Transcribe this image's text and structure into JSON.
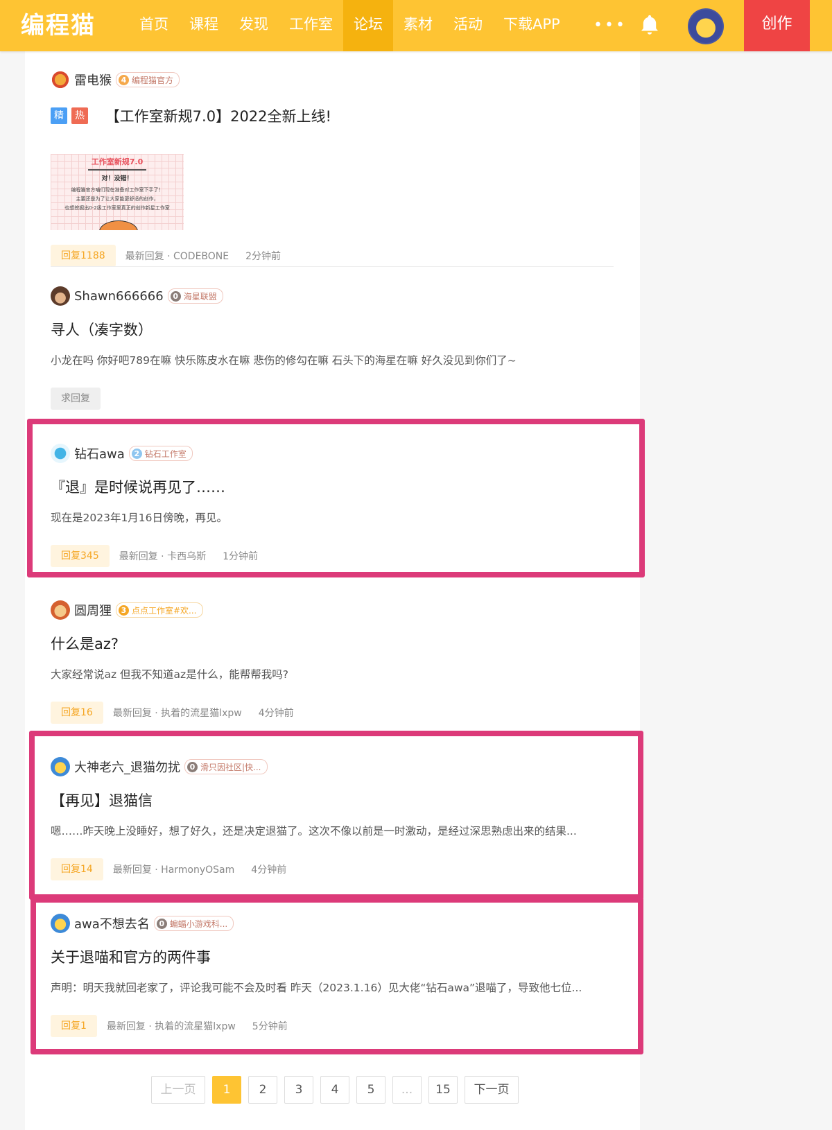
{
  "header": {
    "logo": "编程猫",
    "nav": [
      "首页",
      "课程",
      "发现",
      "工作室",
      "论坛",
      "素材",
      "活动",
      "下载APP"
    ],
    "active_nav": "论坛",
    "more": "•••",
    "create_label": "创作"
  },
  "posts": [
    {
      "author": "雷电猴",
      "badge_level": "4",
      "badge_text": "编程猫官方",
      "tags": [
        "精",
        "热"
      ],
      "title": "【工作室新规7.0】2022全新上线!",
      "thumb": {
        "heading": "工作室新规7.0",
        "sub": "对！没错！",
        "body": [
          "编程猫官方喵们现在准备对工作室下手了！",
          "主要还是为了让大家能更舒适的创作，",
          "也想挖掘出0-2级工作室里真正的创作新星工作室"
        ]
      },
      "reply": "回复1188",
      "latest": "最新回复 · CODEBONE",
      "time": "2分钟前"
    },
    {
      "author": "Shawn666666",
      "badge_level": "0",
      "badge_text": "海星联盟",
      "title": "寻人（凑字数）",
      "excerpt": "小龙在吗  你好吧789在嘛 快乐陈皮水在嘛 悲伤的修勾在嘛 石头下的海星在嘛 好久没见到你们了~",
      "reply": "求回复"
    },
    {
      "author": "钻石awa",
      "badge_level": "2",
      "badge_text": "钻石工作室",
      "title": "『退』是时候说再见了……",
      "excerpt": "现在是2023年1月16日傍晚，再见。",
      "reply": "回复345",
      "latest": "最新回复 · 卡西乌斯",
      "time": "1分钟前"
    },
    {
      "author": "圆周狸",
      "badge_level": "3",
      "badge_text": "点点工作室#欢...",
      "title": "什么是az?",
      "excerpt": "大家经常说az 但我不知道az是什么，能帮帮我吗?",
      "reply": "回复16",
      "latest": "最新回复 · 执着的流星猫lxpw",
      "time": "4分钟前"
    },
    {
      "author": "大神老六_退猫勿扰",
      "badge_level": "0",
      "badge_text": "滑只因社区|快...",
      "title": "【再见】退猫信",
      "excerpt": "嗯……昨天晚上没睡好，想了好久，还是决定退猫了。这次不像以前是一时激动，是经过深思熟虑出来的结果...",
      "reply": "回复14",
      "latest": "最新回复 · HarmonyOSam",
      "time": "4分钟前"
    },
    {
      "author": "awa不想去名",
      "badge_level": "0",
      "badge_text": "蝙蝠小游戏科...",
      "title": "关于退喵和官方的两件事",
      "excerpt": "声明：明天我就回老家了，评论我可能不会及时看 昨天（2023.1.16）见大佬“钻石awa”退喵了，导致他七位...",
      "reply": "回复1",
      "latest": "最新回复 · 执着的流星猫lxpw",
      "time": "5分钟前"
    }
  ],
  "pagination": {
    "prev": "上一页",
    "pages": [
      "1",
      "2",
      "3",
      "4",
      "5",
      "...",
      "15"
    ],
    "current": "1",
    "next": "下一页"
  },
  "colors": {
    "header_bg": "#fec433",
    "active_nav_bg": "#f5b20f",
    "create_bg": "#ef4444",
    "highlight": "#dc3a79",
    "reply_tag_text": "#f5a623"
  }
}
